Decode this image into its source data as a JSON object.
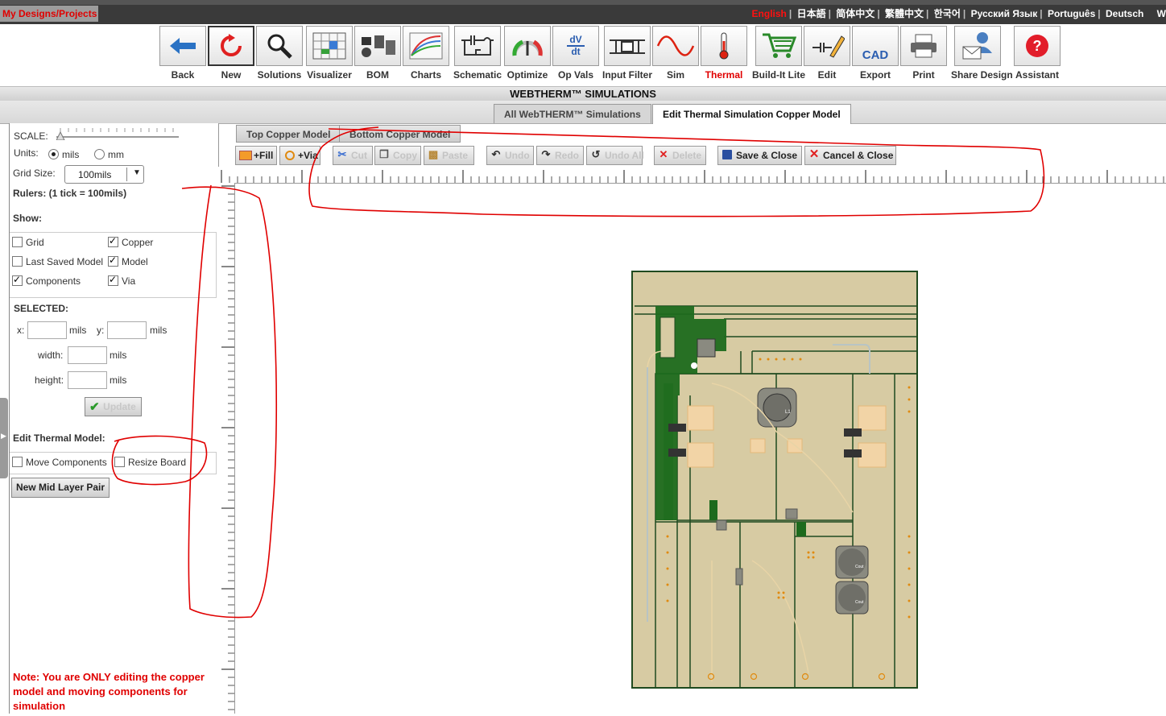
{
  "topbar": {
    "my_designs": "My Designs/Projects",
    "languages": [
      "English",
      "日本語",
      "简体中文",
      "繁體中文",
      "한국어",
      "Русский Язык",
      "Português",
      "Deutsch",
      "W"
    ],
    "active_language": "English"
  },
  "toolbar": {
    "items": [
      {
        "label": "Back",
        "icon": "back-arrow-icon"
      },
      {
        "label": "New",
        "icon": "refresh-icon"
      },
      {
        "label": "Solutions",
        "icon": "magnifier-icon"
      },
      {
        "label": "Visualizer",
        "icon": "visualizer-icon"
      },
      {
        "label": "BOM",
        "icon": "bom-icon"
      },
      {
        "label": "Charts",
        "icon": "charts-icon"
      },
      {
        "label": "Schematic",
        "icon": "schematic-icon"
      },
      {
        "label": "Optimize",
        "icon": "gauge-icon"
      },
      {
        "label": "Op Vals",
        "icon": "dv-dt-icon"
      },
      {
        "label": "Input Filter",
        "icon": "input-filter-icon"
      },
      {
        "label": "Sim",
        "icon": "sine-wave-icon"
      },
      {
        "label": "Thermal",
        "icon": "thermometer-icon"
      },
      {
        "label": "Build-It Lite",
        "icon": "cart-icon"
      },
      {
        "label": "Edit",
        "icon": "edit-icon"
      },
      {
        "label": "Export",
        "icon": "cad-export-icon"
      },
      {
        "label": "Print",
        "icon": "printer-icon"
      },
      {
        "label": "Share Design",
        "icon": "share-design-icon"
      },
      {
        "label": "Assistant",
        "icon": "question-icon"
      }
    ],
    "active": "Thermal",
    "dv_top": "dV",
    "dv_bottom": "dt",
    "cad_text": "CAD"
  },
  "page": {
    "title": "WEBTHERM™ SIMULATIONS",
    "tabs": [
      "All WebTHERM™ Simulations",
      "Edit Thermal Simulation Copper Model"
    ],
    "active_tab": "Edit Thermal Simulation Copper Model"
  },
  "left_panel": {
    "scale_label": "SCALE:",
    "units_label": "Units:",
    "unit_mils": "mils",
    "unit_mm": "mm",
    "selected_unit": "mils",
    "grid_size_label": "Grid Size:",
    "grid_size_value": "100mils",
    "rulers_label": "Rulers: (1 tick = 100mils)",
    "show_label": "Show:",
    "show_options": [
      {
        "label": "Grid",
        "checked": false
      },
      {
        "label": "Copper",
        "checked": true
      },
      {
        "label": "Last Saved Model",
        "checked": false
      },
      {
        "label": "Model",
        "checked": true
      },
      {
        "label": "Components",
        "checked": true
      },
      {
        "label": "Via",
        "checked": true
      }
    ],
    "selected_label": "SELECTED:",
    "x_label": "x:",
    "y_label": "y:",
    "width_label": "width:",
    "height_label": "height:",
    "mils": "mils",
    "update_label": "Update",
    "edit_model_label": "Edit Thermal Model:",
    "move_components_label": "Move Components",
    "resize_board_label": "Resize Board",
    "new_mid_layer_label": "New Mid Layer Pair",
    "note": "Note: You are ONLY editing the copper model and moving components for simulation"
  },
  "editor": {
    "subtabs": [
      "Top Copper Model",
      "Bottom Copper Model"
    ],
    "buttons": [
      {
        "label": "+Fill",
        "icon": "fill-icon",
        "enabled": true
      },
      {
        "label": "+Via",
        "icon": "via-icon",
        "enabled": true
      },
      {
        "label": "Cut",
        "icon": "scissors-icon",
        "enabled": false
      },
      {
        "label": "Copy",
        "icon": "copy-icon",
        "enabled": false
      },
      {
        "label": "Paste",
        "icon": "paste-icon",
        "enabled": false
      },
      {
        "label": "Undo",
        "icon": "undo-icon",
        "enabled": false
      },
      {
        "label": "Redo",
        "icon": "redo-icon",
        "enabled": false
      },
      {
        "label": "Undo All",
        "icon": "undo-all-icon",
        "enabled": false
      },
      {
        "label": "Delete",
        "icon": "delete-icon",
        "enabled": false
      },
      {
        "label": "Save & Close",
        "icon": "save-icon",
        "enabled": true
      },
      {
        "label": "Cancel & Close",
        "icon": "cancel-icon",
        "enabled": true
      }
    ]
  },
  "board_labels": {
    "inductor": "L1",
    "cout1": "Cout",
    "cout2": "Cout",
    "u1": "U1"
  },
  "colors": {
    "board_bg": "#d7cba3",
    "board_outline": "#1f4a1f",
    "copper_green": "#1d6a1d",
    "annotation_red": "#e00000"
  }
}
